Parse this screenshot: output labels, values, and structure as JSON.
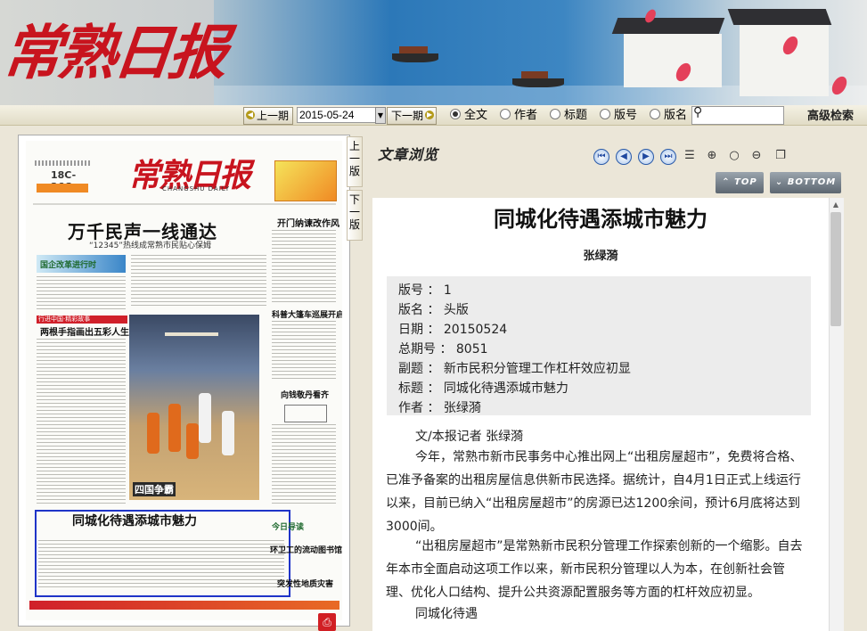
{
  "banner": {
    "logo_text": "常熟日报"
  },
  "toolbar": {
    "prev_label": "上一期",
    "date_value": "2015-05-24",
    "next_label": "下一期",
    "search_modes": [
      {
        "label": "全文",
        "selected": true
      },
      {
        "label": "作者",
        "selected": false
      },
      {
        "label": "标题",
        "selected": false
      },
      {
        "label": "版号",
        "selected": false
      },
      {
        "label": "版名",
        "selected": false
      }
    ],
    "advanced_label": "高级检索"
  },
  "page_nav": {
    "prev_page": "上一版",
    "next_page": "下一版"
  },
  "newspaper": {
    "masthead": "常熟日报",
    "masthead_sub": "CHANGSHU DAILY",
    "lead_headline": "万千民声一线通达",
    "lead_sub": "“12345”热线成常熟市民贴心保姆",
    "heads": {
      "h_open": "开门纳谏改作风",
      "h_green": "两根手指画出五彩人生",
      "h_tag": "行进中国·精彩故事",
      "h_science": "科普大篷车巡展开启",
      "h_peony": "向钱敬丹看齐",
      "h_photo_caption": "四国争霸",
      "h_today": "今日导读",
      "h_worker": "环卫工的流动图书馆",
      "h_dev": "突发性地质灾害",
      "h_boxed": "同城化待遇添城市魅力",
      "h_banner": "国企改革进行时"
    }
  },
  "reader": {
    "pane_title": "文章浏览",
    "top_label": "TOP",
    "bottom_label": "BOTTOM",
    "tools": [
      "first-icon",
      "prev-icon",
      "next-icon",
      "last-icon",
      "list-icon",
      "zoom-in-icon",
      "zoom-reset-icon",
      "zoom-out-icon",
      "copy-icon"
    ],
    "title": "同城化待遇添城市魅力",
    "author": "张绿漪",
    "meta": [
      "版号 ： 1",
      "版名 ： 头版",
      "日期 ： 20150524",
      "总期号 ： 8051",
      "副题 ： 新市民积分管理工作杠杆效应初显",
      "标题 ： 同城化待遇添城市魅力",
      "作者 ： 张绿漪"
    ],
    "byline": "文/本报记者 张绿漪",
    "p1": "今年，常熟市新市民事务中心推出网上“出租房屋超市”，免费将合格、已准予备案的出租房屋信息供新市民选择。据统计，自4月1日正式上线运行以来，目前已纳入“出租房屋超市”的房源已达1200余间，预计6月底将达到3000间。",
    "p2": "“出租房屋超市”是常熟新市民积分管理工作探索创新的一个缩影。自去年本市全面启动这项工作以来，新市民积分管理以人为本，在创新社会管理、优化人口结构、提升公共资源配置服务等方面的杠杆效应初显。",
    "p3": "同城化待遇"
  },
  "colors": {
    "logo_red": "#c8141e",
    "boxed_blue": "#1f34c8"
  }
}
